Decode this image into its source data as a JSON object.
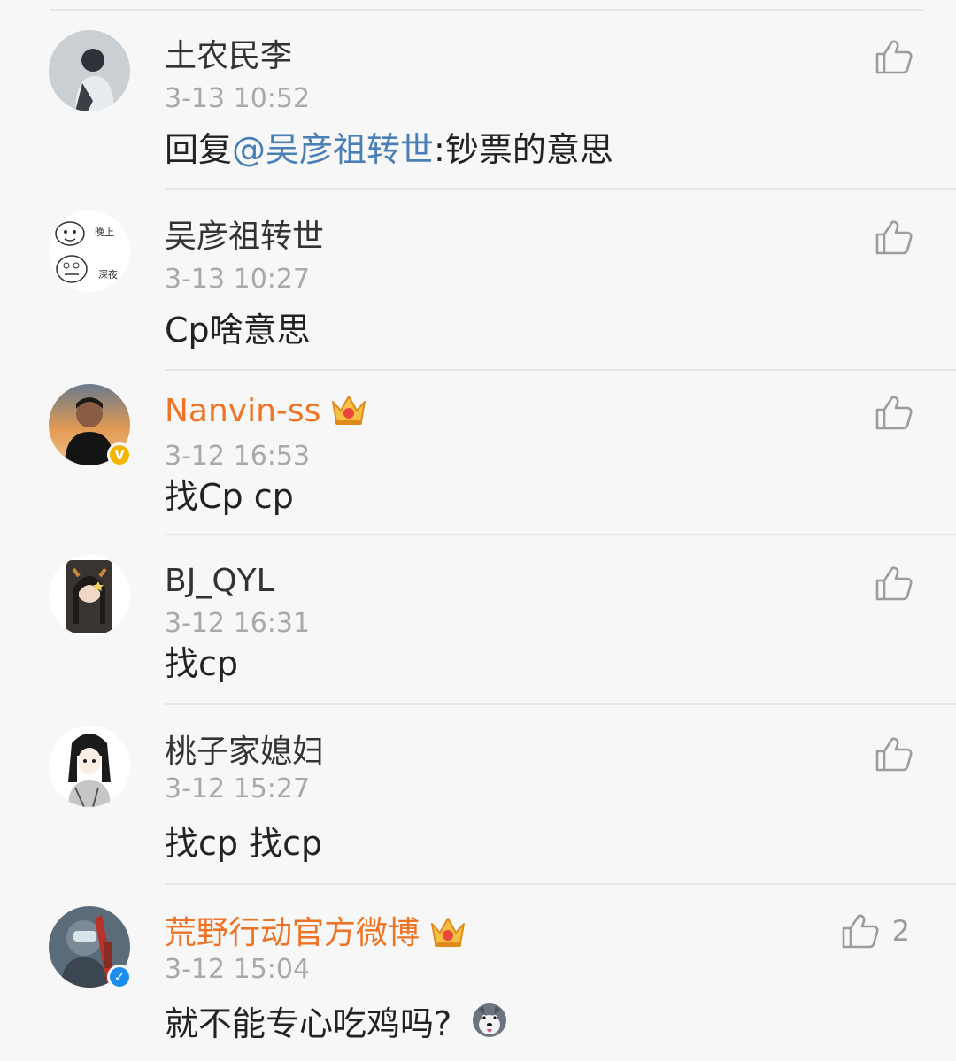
{
  "comments": [
    {
      "user": "土农民李",
      "vip": false,
      "verified": null,
      "time": "3-13 10:52",
      "reply_prefix": "回复",
      "mention": "@吴彦祖转世",
      "text": ":钞票的意思",
      "likes": ""
    },
    {
      "user": "吴彦祖转世",
      "vip": false,
      "verified": null,
      "time": "3-13 10:27",
      "reply_prefix": "",
      "mention": "",
      "text": "Cp啥意思",
      "likes": "",
      "avatar_text": [
        "晚上",
        "深夜"
      ]
    },
    {
      "user": "Nanvin-ss",
      "vip": true,
      "verified": "yellow",
      "time": "3-12 16:53",
      "reply_prefix": "",
      "mention": "",
      "text": "找Cp cp",
      "likes": ""
    },
    {
      "user": "BJ_QYL",
      "vip": false,
      "verified": null,
      "time": "3-12 16:31",
      "reply_prefix": "",
      "mention": "",
      "text": "找cp",
      "likes": ""
    },
    {
      "user": "桃子家媳妇",
      "vip": false,
      "verified": null,
      "time": "3-12 15:27",
      "reply_prefix": "",
      "mention": "",
      "text": "找cp  找cp",
      "likes": ""
    },
    {
      "user": "荒野行动官方微博",
      "vip": true,
      "verified": "blue",
      "time": "3-12 15:04",
      "reply_prefix": "",
      "mention": "",
      "text": "就不能专心吃鸡吗?",
      "likes": "2"
    }
  ],
  "colors": {
    "vip_name": "#ee7325",
    "mention": "#4a7fb5",
    "time": "#a9a9a9",
    "icon": "#9c9c9c"
  },
  "icons": {
    "like": "thumbs-up-icon",
    "vip": "crown-icon",
    "verified": "verified-v-icon",
    "emoji": "husky-emoji-icon"
  }
}
